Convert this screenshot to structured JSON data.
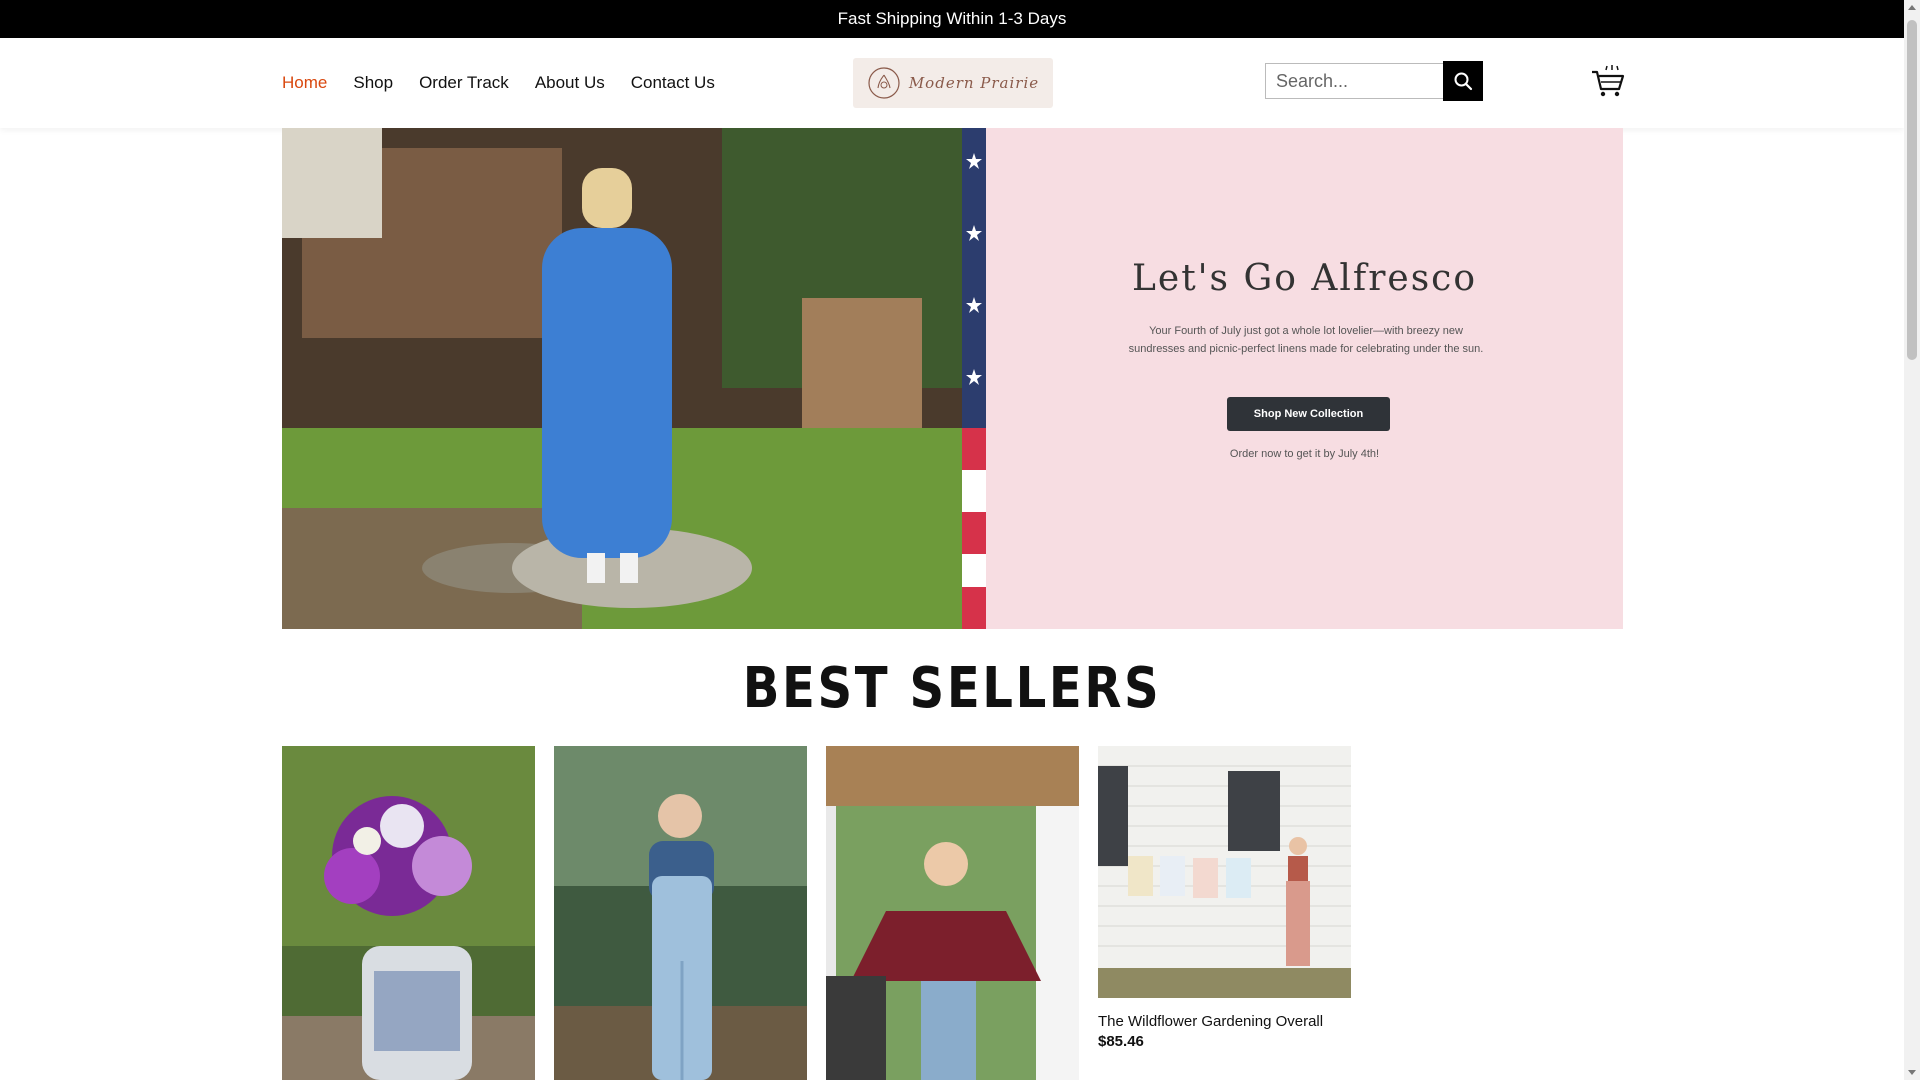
{
  "announcement": "Fast Shipping Within 1-3 Days",
  "nav": {
    "home": "Home",
    "shop": "Shop",
    "order_track": "Order Track",
    "about": "About Us",
    "contact": "Contact Us"
  },
  "logo": {
    "text": "Modern Prairie"
  },
  "search": {
    "placeholder": "Search..."
  },
  "hero": {
    "title": "Let's Go Alfresco",
    "body": "Your Fourth of July just got a whole lot lovelier—with breezy new sundresses and picnic-perfect linens made for celebrating under the sun.",
    "button": "Shop New Collection",
    "note": "Order now to get it by July 4th!"
  },
  "best_sellers": {
    "title": "BEST SELLERS",
    "products": [
      {
        "name": "",
        "price": ""
      },
      {
        "name": "",
        "price": ""
      },
      {
        "name": "",
        "price": ""
      },
      {
        "name": "The Wildflower Gardening Overall",
        "price": "$85.46"
      }
    ]
  },
  "colors": {
    "announcement_bg": "#000000",
    "nav_active": "#d9480f",
    "hero_panel": "#f7dde2",
    "button_bg": "#2f3338"
  },
  "icons": [
    "search-icon",
    "cart-icon",
    "logo-icon"
  ]
}
